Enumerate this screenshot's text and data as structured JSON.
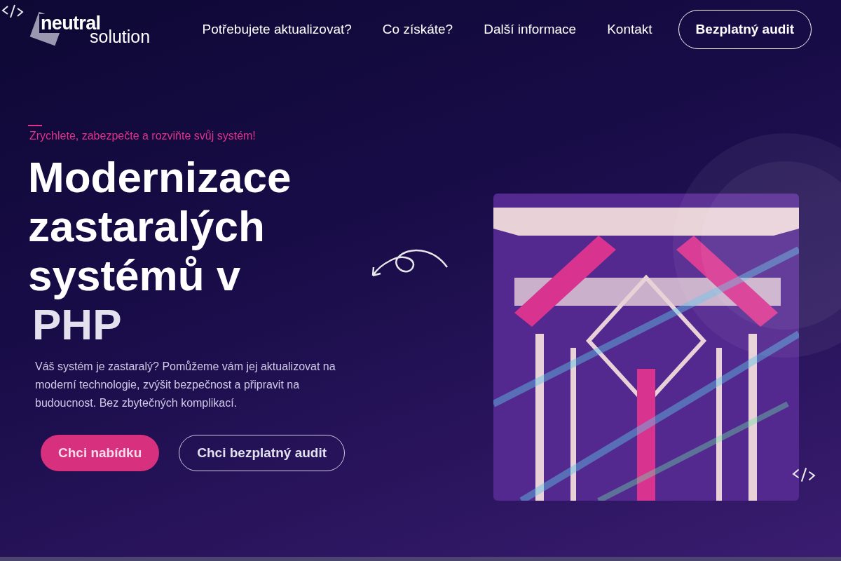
{
  "logo": {
    "word_1": "neutral",
    "word_2": "solution"
  },
  "nav": {
    "links": [
      "Potřebujete aktualizovat?",
      "Co získáte?",
      "Další informace",
      "Kontakt"
    ],
    "cta": "Bezplatný audit"
  },
  "hero": {
    "eyebrow": "Zrychlete, zabezpečte a rozviňte svůj systém!",
    "title": "Modernizace zastaralých systémů v",
    "title_highlight": "PHP",
    "description": "Váš systém je zastaralý? Pomůžeme vám jej aktualizovat na moderní technologie, zvýšit bezpečnost a připravit na budoucnost. Bez zbytečných komplikací.",
    "buttons": [
      {
        "label": "Chci nabídku",
        "kind": "primary"
      },
      {
        "label": "Chci bezplatný audit",
        "kind": "outline"
      }
    ]
  }
}
